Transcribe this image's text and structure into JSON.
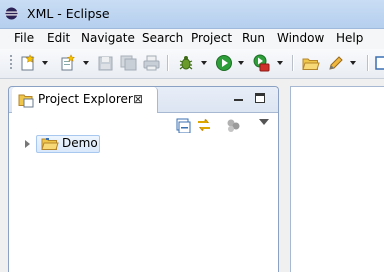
{
  "window": {
    "title": "XML - Eclipse"
  },
  "menubar": {
    "items": [
      "File",
      "Edit",
      "Navigate",
      "Search",
      "Project",
      "Run",
      "Window",
      "Help"
    ]
  },
  "toolbar": {
    "buttons": [
      "new-wizard-icon",
      "new-file-icon",
      "save-icon",
      "save-all-icon",
      "print-icon",
      "debug-icon",
      "run-icon",
      "external-tools-icon",
      "open-folder-icon",
      "edit-icon"
    ]
  },
  "view": {
    "tab_label": "Project Explorer",
    "close_glyph": "⊠",
    "tree": [
      {
        "label": "Demo",
        "icon": "folder-open-icon",
        "expanded": false,
        "selected": true
      }
    ]
  },
  "colors": {
    "titlebar": "#c9ddf4",
    "view_border": "#8aa1c3",
    "selection": "#d9e8fb",
    "run_green": "#2e9e3a"
  }
}
